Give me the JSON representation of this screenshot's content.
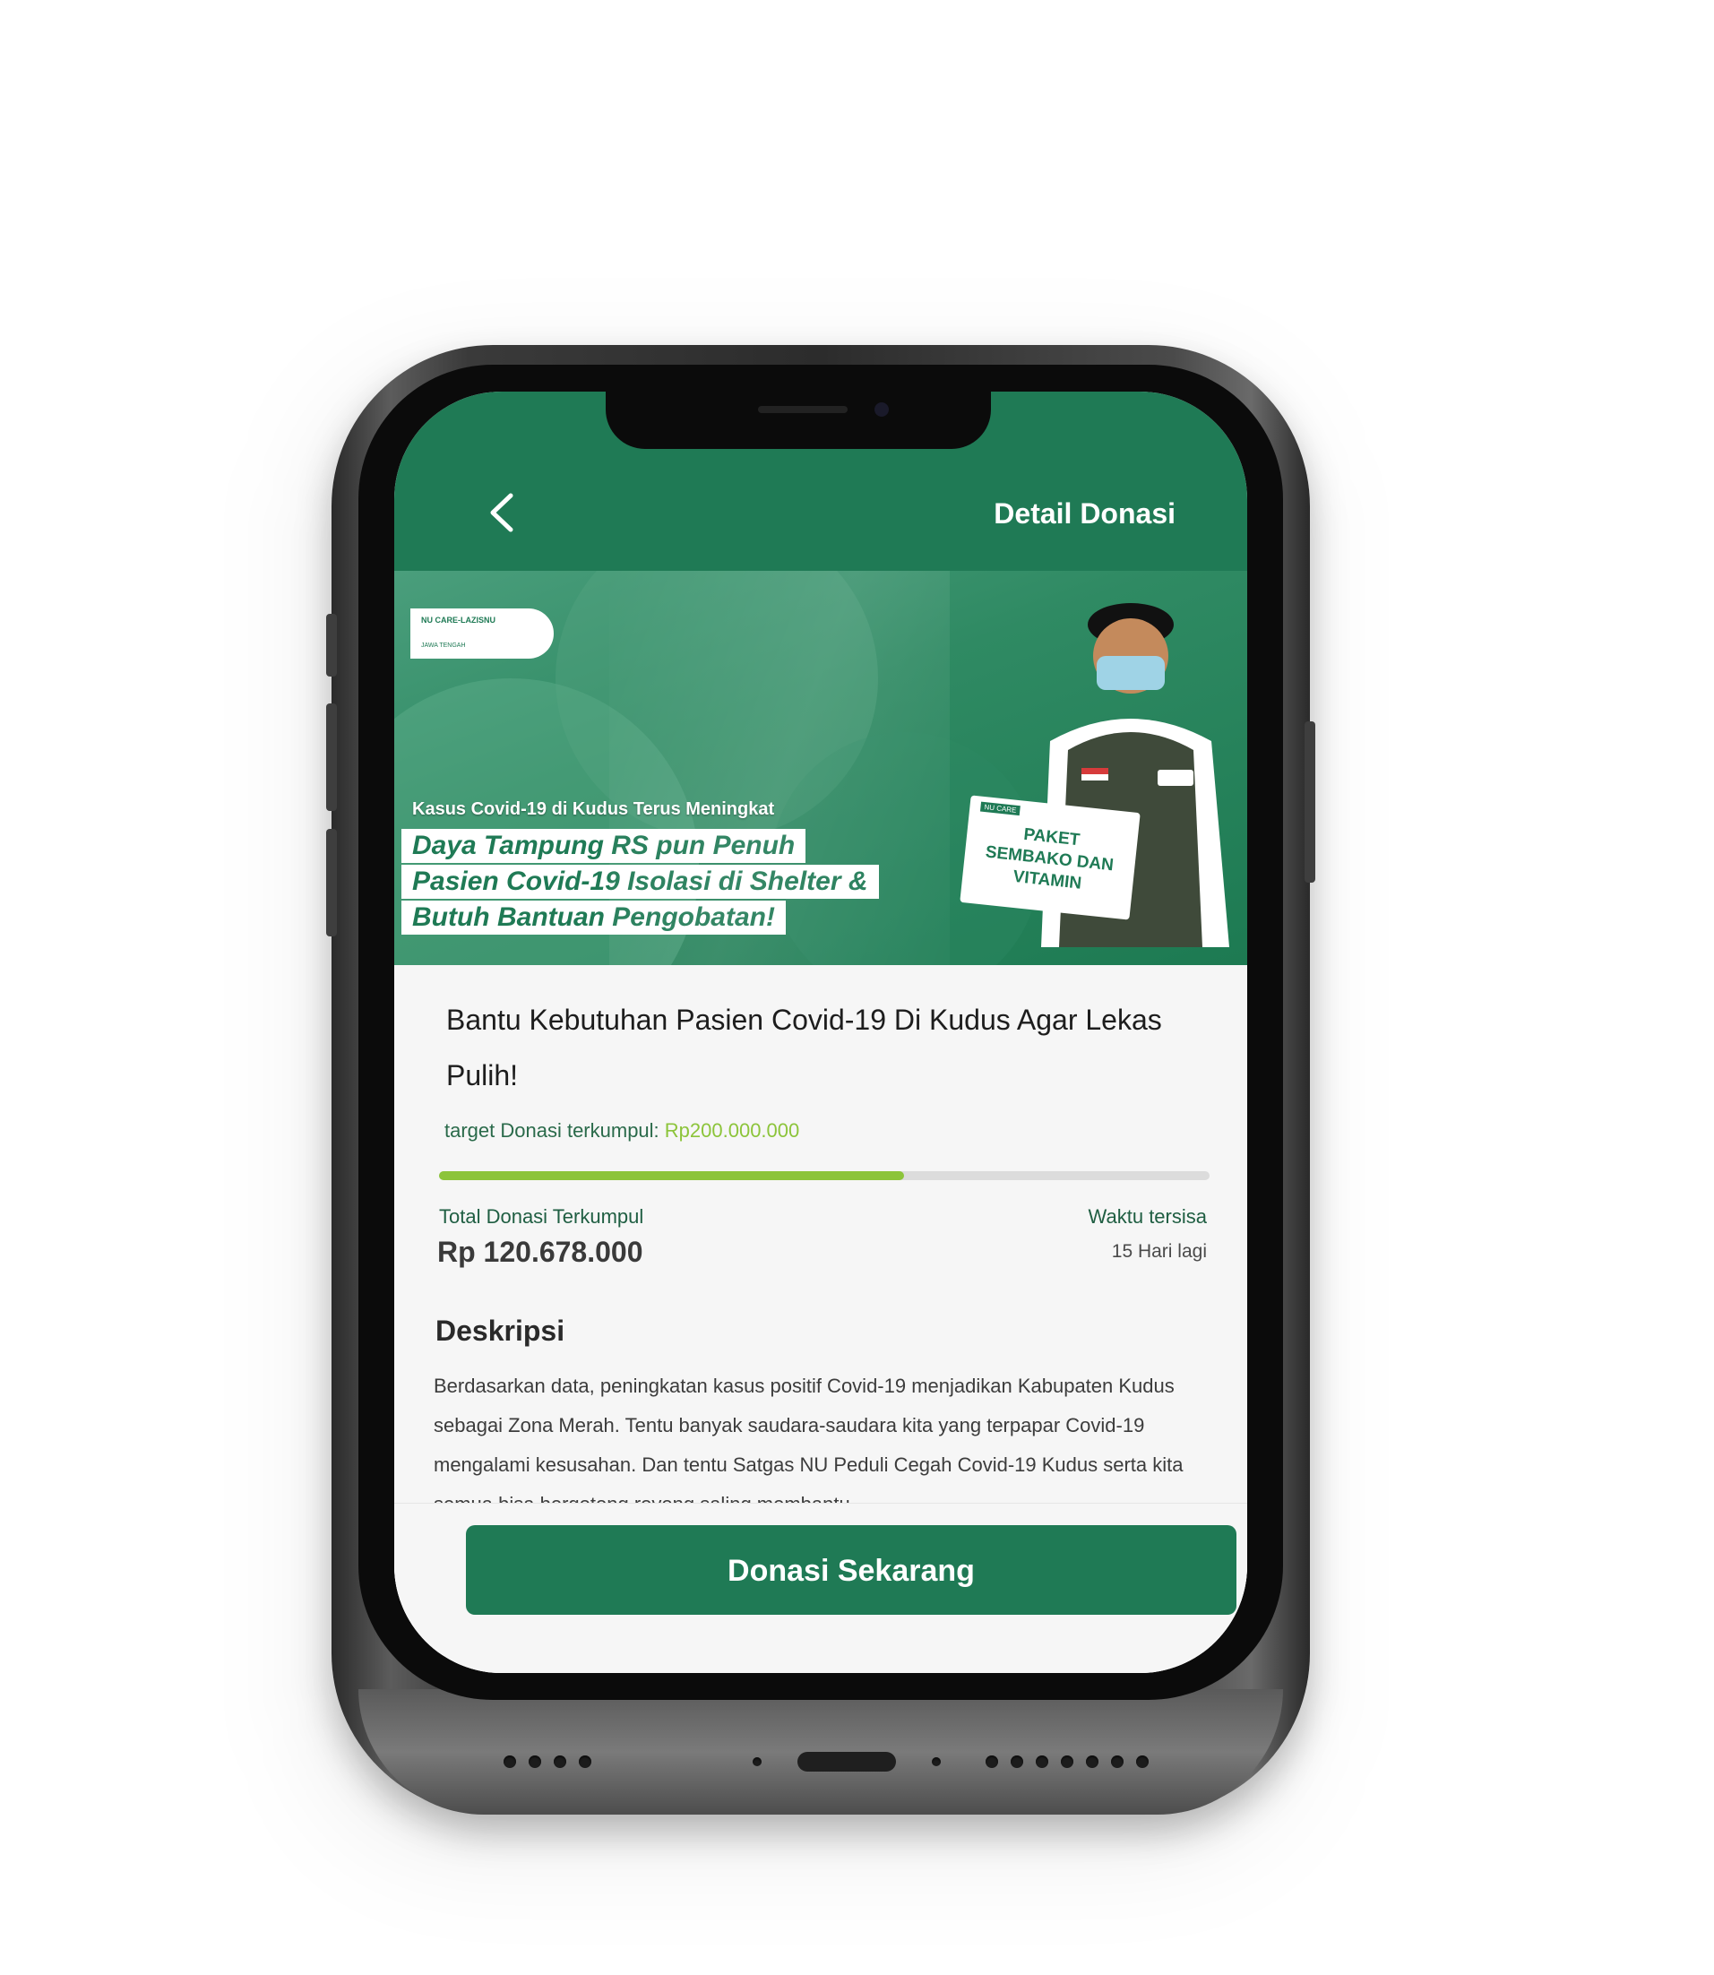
{
  "header": {
    "title": "Detail Donasi",
    "back_icon": "chevron-left-icon"
  },
  "banner": {
    "logo_text": "NU CARE-LAZISNU",
    "logo_sub": "JAWA TENGAH",
    "kicker": "Kasus Covid-19 di Kudus Terus Meningkat",
    "lines": [
      "Daya Tampung RS pun Penuh",
      "Pasien Covid-19 Isolasi di Shelter &",
      "Butuh Bantuan Pengobatan!"
    ],
    "box_label": "NU CARE",
    "box_text": "PAKET SEMBAKO DAN VITAMIN"
  },
  "campaign": {
    "title": "Bantu Kebutuhan Pasien Covid-19 Di Kudus Agar Lekas Pulih!",
    "target_label": "target Donasi terkumpul: ",
    "target_amount": "Rp200.000.000",
    "progress_fraction": 0.6034,
    "total_label": "Total Donasi Terkumpul",
    "total_value": "Rp 120.678.000",
    "time_label": "Waktu tersisa",
    "time_value": "15 Hari lagi"
  },
  "description": {
    "heading": "Deskripsi",
    "body": "Berdasarkan data, peningkatan kasus positif Covid-19 menjadikan Kabupaten Kudus sebagai Zona Merah. Tentu banyak saudara-saudara kita yang terpapar Covid-19 mengalami kesusahan. Dan tentu Satgas NU Peduli Cegah Covid-19 Kudus serta kita semua bisa bergotong royong saling membantu."
  },
  "footer": {
    "donate_label": "Donasi Sekarang"
  },
  "colors": {
    "brand_green": "#1f7a55",
    "accent_lime": "#8cc43a",
    "background": "#f6f6f6"
  }
}
